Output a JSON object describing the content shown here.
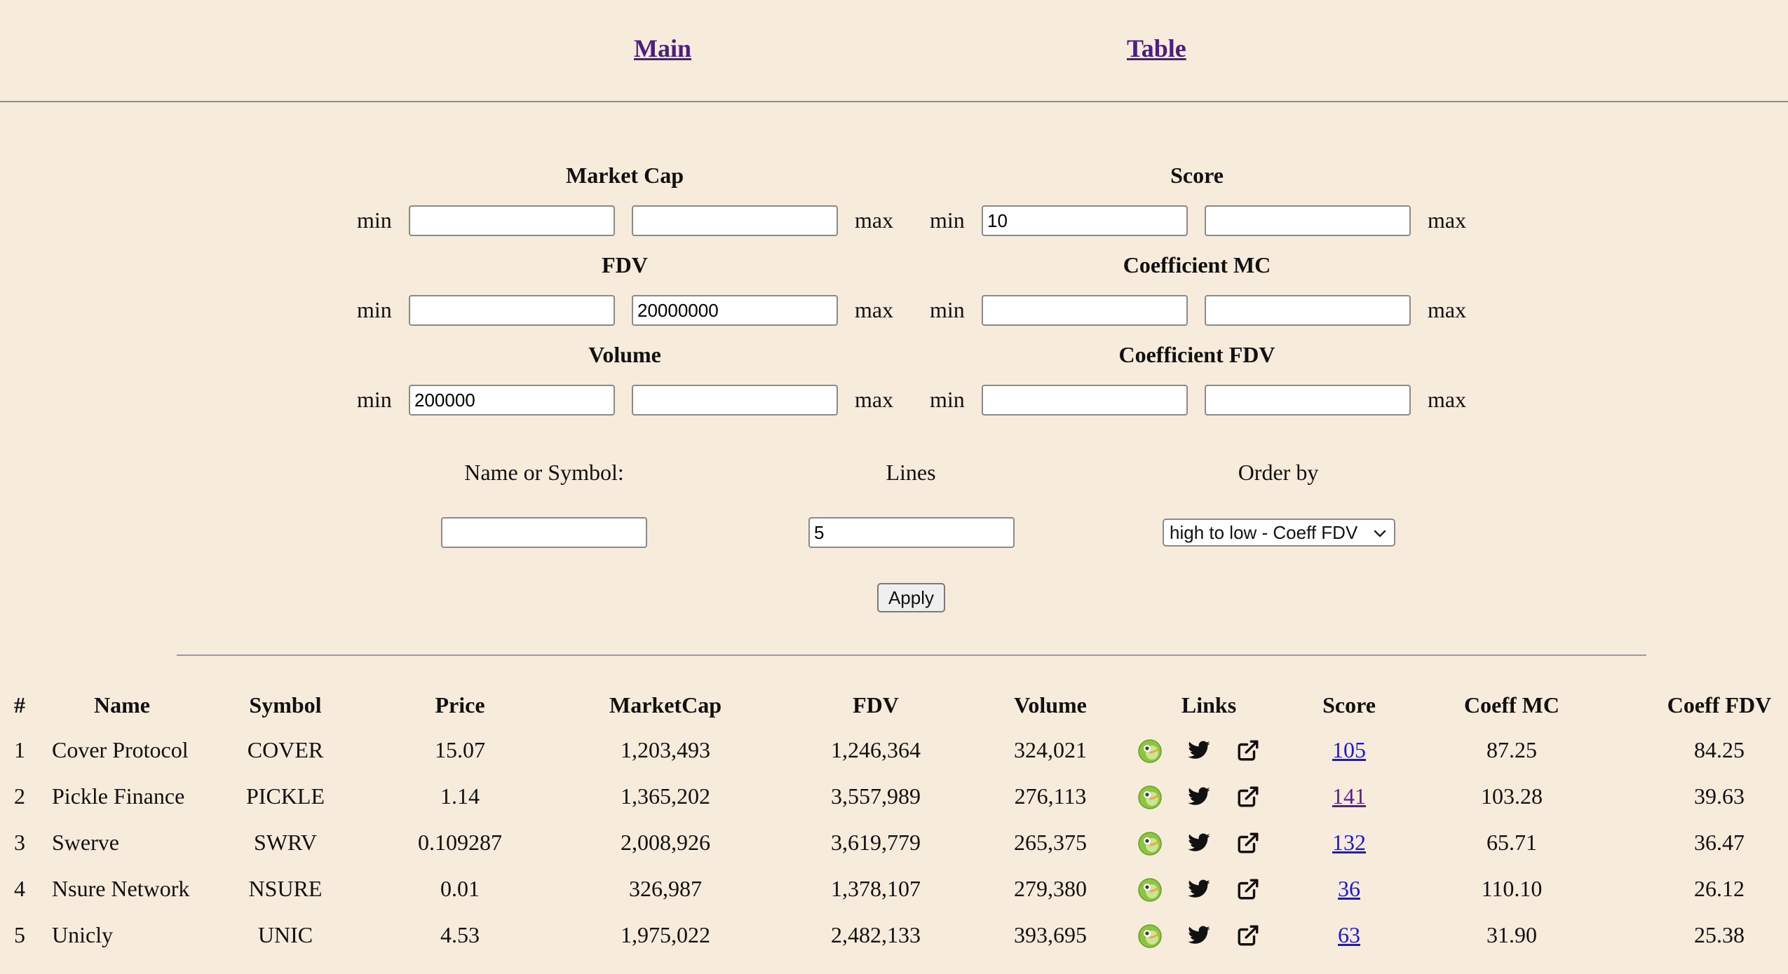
{
  "nav": {
    "main": "Main",
    "table": "Table"
  },
  "filters": {
    "min_label": "min",
    "max_label": "max",
    "market_cap": {
      "label": "Market Cap",
      "min": "",
      "max": ""
    },
    "score": {
      "label": "Score",
      "min": "10",
      "max": ""
    },
    "fdv": {
      "label": "FDV",
      "min": "",
      "max": "20000000"
    },
    "coeff_mc": {
      "label": "Coefficient MC",
      "min": "",
      "max": ""
    },
    "volume": {
      "label": "Volume",
      "min": "200000",
      "max": ""
    },
    "coeff_fdv": {
      "label": "Coefficient FDV",
      "min": "",
      "max": ""
    },
    "name_or_symbol": {
      "label": "Name or Symbol:",
      "value": ""
    },
    "lines": {
      "label": "Lines",
      "value": "5"
    },
    "order_by": {
      "label": "Order by",
      "value": "high to low - Coeff FDV"
    },
    "apply_label": "Apply"
  },
  "table": {
    "headers": {
      "num": "#",
      "name": "Name",
      "symbol": "Symbol",
      "price": "Price",
      "marketcap": "MarketCap",
      "fdv": "FDV",
      "volume": "Volume",
      "links": "Links",
      "score": "Score",
      "coeff_mc": "Coeff MC",
      "coeff_fdv": "Coeff FDV"
    },
    "rows": [
      {
        "num": "1",
        "name": "Cover Protocol",
        "symbol": "COVER",
        "price": "15.07",
        "marketcap": "1,203,493",
        "fdv": "1,246,364",
        "volume": "324,021",
        "score": "105",
        "coeff_mc": "87.25",
        "coeff_fdv": "84.25"
      },
      {
        "num": "2",
        "name": "Pickle Finance",
        "symbol": "PICKLE",
        "price": "1.14",
        "marketcap": "1,365,202",
        "fdv": "3,557,989",
        "volume": "276,113",
        "score": "141",
        "coeff_mc": "103.28",
        "coeff_fdv": "39.63"
      },
      {
        "num": "3",
        "name": "Swerve",
        "symbol": "SWRV",
        "price": "0.109287",
        "marketcap": "2,008,926",
        "fdv": "3,619,779",
        "volume": "265,375",
        "score": "132",
        "coeff_mc": "65.71",
        "coeff_fdv": "36.47"
      },
      {
        "num": "4",
        "name": "Nsure Network",
        "symbol": "NSURE",
        "price": "0.01",
        "marketcap": "326,987",
        "fdv": "1,378,107",
        "volume": "279,380",
        "score": "36",
        "coeff_mc": "110.10",
        "coeff_fdv": "26.12"
      },
      {
        "num": "5",
        "name": "Unicly",
        "symbol": "UNIC",
        "price": "4.53",
        "marketcap": "1,975,022",
        "fdv": "2,482,133",
        "volume": "393,695",
        "score": "63",
        "coeff_mc": "31.90",
        "coeff_fdv": "25.38"
      }
    ],
    "link_icons": [
      "coingecko-icon",
      "twitter-icon",
      "external-link-icon"
    ]
  },
  "colors": {
    "background": "#f7ebdb",
    "nav_link": "#4b1e82",
    "score_link": "#1a1ad6",
    "score_link_visited": "#5b1e8c"
  }
}
